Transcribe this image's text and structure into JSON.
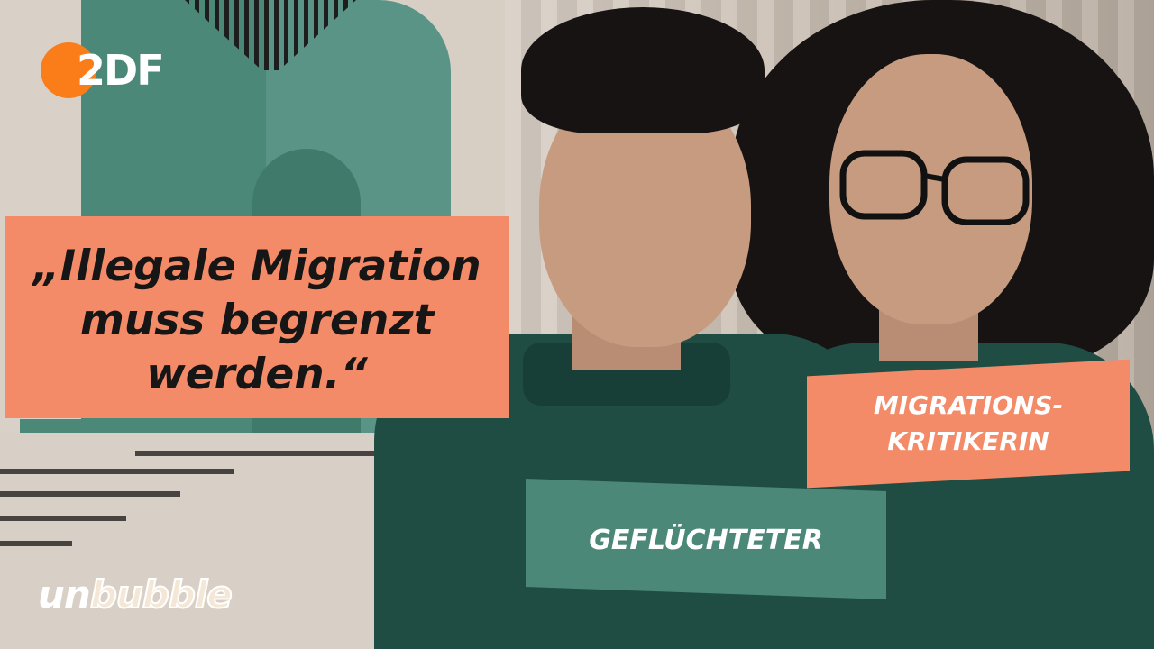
{
  "brand": {
    "broadcaster_logo_text": "2DF",
    "show_logo": {
      "prefix": "un",
      "suffix": "bubble"
    }
  },
  "quote": {
    "text": "„Illegale Migration\nmuss begrenzt\nwerden.“"
  },
  "labels": {
    "left_person_role": "GEFLÜCHTETER",
    "right_person_role": "MIGRATIONS-\nKRITIKERIN"
  },
  "colors": {
    "accent_orange": "#f38b68",
    "accent_teal": "#4c8878",
    "zdf_orange": "#fa7d19"
  }
}
